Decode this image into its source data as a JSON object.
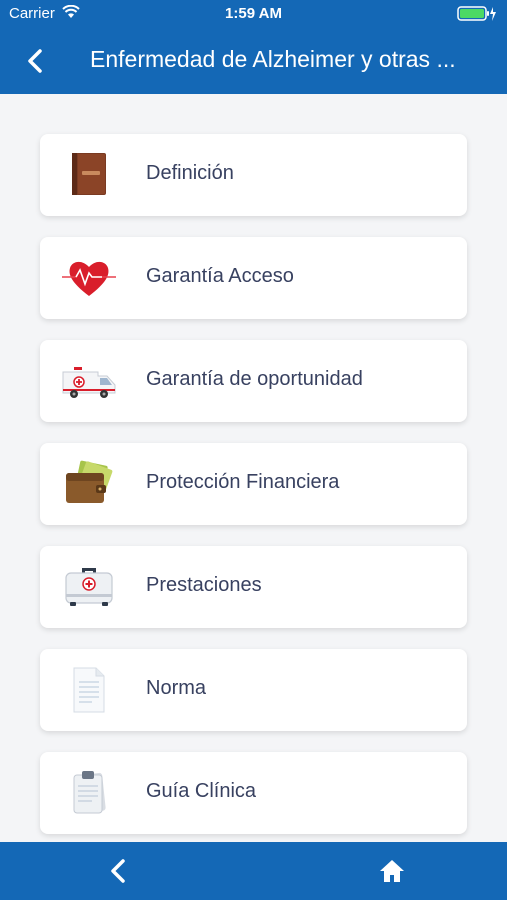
{
  "status_bar": {
    "carrier": "Carrier",
    "time": "1:59 AM"
  },
  "header": {
    "title": "Enfermedad de Alzheimer y otras ...",
    "back_icon": "chevron-left-icon"
  },
  "menu": {
    "items": [
      {
        "label": "Definición",
        "icon": "book-icon"
      },
      {
        "label": "Garantía Acceso",
        "icon": "heart-pulse-icon"
      },
      {
        "label": "Garantía de oportunidad",
        "icon": "ambulance-icon"
      },
      {
        "label": "Protección Financiera",
        "icon": "wallet-icon"
      },
      {
        "label": "Prestaciones",
        "icon": "first-aid-kit-icon"
      },
      {
        "label": "Norma",
        "icon": "document-icon"
      },
      {
        "label": "Guía Clínica",
        "icon": "clipboard-icon"
      }
    ]
  },
  "bottom_bar": {
    "back_icon": "chevron-left-icon",
    "home_icon": "home-icon"
  },
  "colors": {
    "primary": "#1468b6",
    "background": "#f4f5f7",
    "card": "#ffffff",
    "label": "#384160"
  }
}
